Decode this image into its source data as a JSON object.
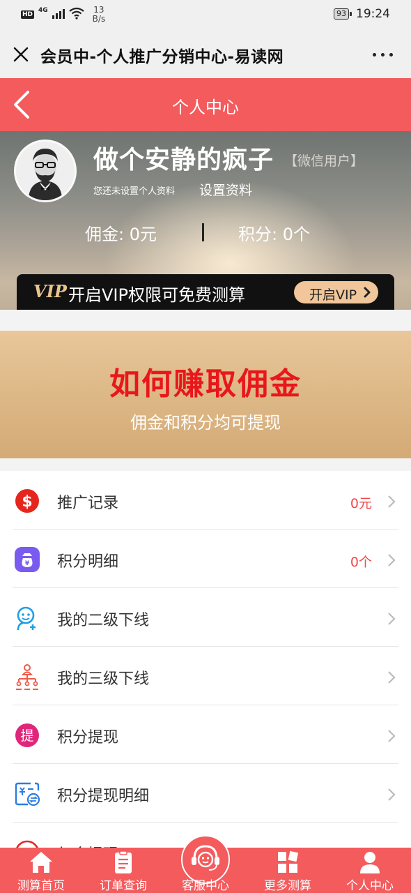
{
  "status_bar": {
    "hd": "HD",
    "network": "4G",
    "speed_value": "13",
    "speed_unit": "B/s",
    "battery": "93",
    "time": "19:24"
  },
  "titlebar": {
    "title": "会员中-个人推广分销中心-易读网"
  },
  "header": {
    "title": "个人中心"
  },
  "profile": {
    "name": "做个安静的疯子",
    "user_type": "【微信用户】",
    "hint": "您还未设置个人资料",
    "setup_link": "设置资料",
    "commission": "佣金:  0元",
    "points": "积分:  0个"
  },
  "vip": {
    "logo": "VIP",
    "text": "开启VIP权限可免费测算",
    "button": "开启VIP"
  },
  "earn_banner": {
    "title": "如何赚取佣金",
    "subtitle": "佣金和积分均可提现"
  },
  "menu": {
    "items": [
      {
        "label": "推广记录",
        "value": "0元",
        "icon": "dollar-icon"
      },
      {
        "label": "积分明细",
        "value": "0个",
        "icon": "money-bag-icon"
      },
      {
        "label": "我的二级下线",
        "value": "",
        "icon": "user-add-icon"
      },
      {
        "label": "我的三级下线",
        "value": "",
        "icon": "org-chart-icon"
      },
      {
        "label": "积分提现",
        "value": "",
        "icon": "withdraw-icon"
      },
      {
        "label": "积分提现明细",
        "value": "",
        "icon": "exchange-icon"
      },
      {
        "label": "佣金提现",
        "value": "",
        "icon": "commission-withdraw-icon"
      }
    ]
  },
  "bottom_nav": {
    "items": [
      {
        "label": "测算首页",
        "icon": "home-icon"
      },
      {
        "label": "订单查询",
        "icon": "clipboard-icon"
      },
      {
        "label": "客服中心",
        "icon": "headset-icon"
      },
      {
        "label": "更多测算",
        "icon": "apps-grid-icon"
      },
      {
        "label": "个人中心",
        "icon": "user-icon"
      }
    ]
  },
  "colors": {
    "primary_red": "#f35b5d",
    "earn_title_red": "#e8171b",
    "vip_gold": "#f0c69a"
  }
}
